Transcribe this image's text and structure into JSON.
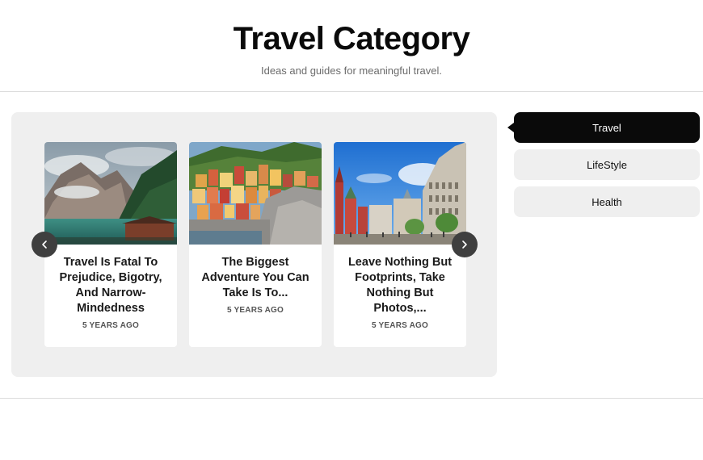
{
  "header": {
    "title": "Travel Category",
    "subtitle": "Ideas and guides for meaningful travel."
  },
  "carousel": {
    "prev_icon": "chevron-left-icon",
    "next_icon": "chevron-right-icon",
    "cards": [
      {
        "title": "Travel Is Fatal To Prejudice, Bigotry, And Narrow-Mindedness",
        "meta": "5 YEARS AGO",
        "image": "mountain-lake-photo"
      },
      {
        "title": "The Biggest Adventure You Can Take Is To...",
        "meta": "5 YEARS AGO",
        "image": "coastal-village-photo"
      },
      {
        "title": "Leave Nothing But Footprints, Take Nothing But Photos,...",
        "meta": "5 YEARS AGO",
        "image": "city-square-photo"
      }
    ]
  },
  "tabs": [
    {
      "label": "Travel",
      "active": true
    },
    {
      "label": "LifeStyle",
      "active": false
    },
    {
      "label": "Health",
      "active": false
    }
  ],
  "colors": {
    "accent": "#0a0a0a",
    "panel": "#efefef",
    "nav_button": "#3f3f3f"
  }
}
